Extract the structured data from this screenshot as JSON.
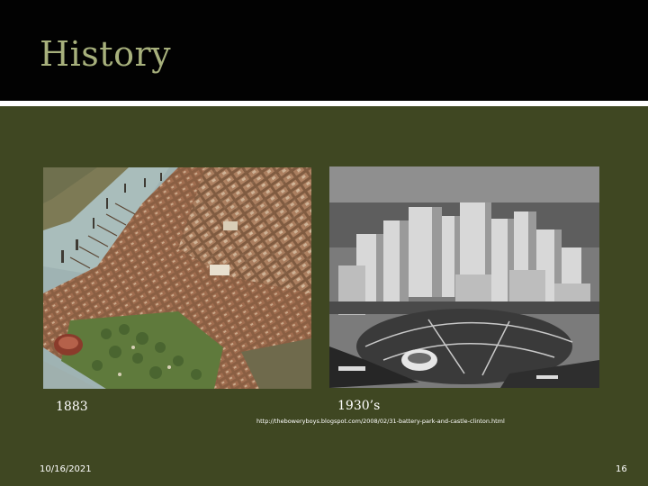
{
  "slide": {
    "title": "History",
    "source_url": "http://theboweryboys.blogspot.com/2008/02/31-battery-park-and-castle-clinton.html",
    "date": "10/16/2021",
    "page_number": "16"
  },
  "images": [
    {
      "caption": "1883",
      "description_icon": "illustrated-map-icon"
    },
    {
      "caption": "1930’s",
      "description_icon": "aerial-photo-icon"
    }
  ],
  "colors": {
    "title_bar": "#020202",
    "title_text": "#a7b07c",
    "slide_background": "#3f4722",
    "rule": "#ffffff"
  }
}
